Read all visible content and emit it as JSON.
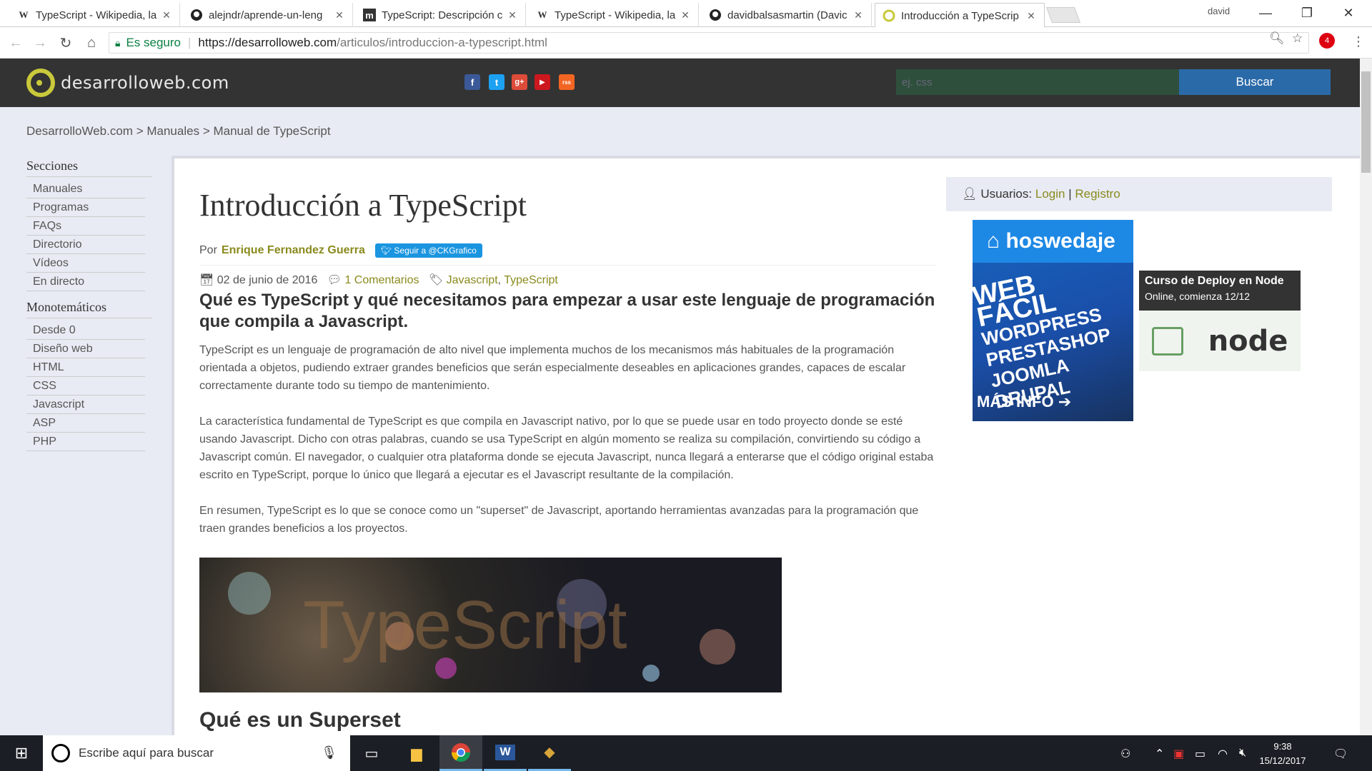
{
  "browser": {
    "tabs": [
      {
        "title": "TypeScript - Wikipedia, la",
        "favicon": "W"
      },
      {
        "title": "alejndr/aprende-un-leng",
        "favicon": "github-icon"
      },
      {
        "title": "TypeScript: Descripción c",
        "favicon": "m"
      },
      {
        "title": "TypeScript - Wikipedia, la",
        "favicon": "W"
      },
      {
        "title": "davidbalsasmartin (Davic",
        "favicon": "github-icon"
      },
      {
        "title": "Introducción a TypeScrip",
        "favicon": "dw"
      }
    ],
    "user": "david",
    "secure_label": "Es seguro",
    "url_host": "https://desarrolloweb.com",
    "url_path": "/articulos/introduccion-a-typescript.html",
    "ext_badge": "4"
  },
  "site": {
    "logo": "desarrolloweb.com",
    "social": [
      "f",
      "t",
      "g+",
      "▶",
      "rss"
    ],
    "search_placeholder": "ej. css",
    "search_button": "Buscar",
    "breadcrumb": [
      "DesarrolloWeb.com",
      "Manuales",
      "Manual de TypeScript"
    ]
  },
  "sidebar": {
    "sections_title": "Secciones",
    "sections": [
      "Manuales",
      "Programas",
      "FAQs",
      "Directorio",
      "Vídeos",
      "En directo"
    ],
    "mono_title": "Monotemáticos",
    "mono": [
      "Desde 0",
      "Diseño web",
      "HTML",
      "CSS",
      "Javascript",
      "ASP",
      "PHP"
    ]
  },
  "article": {
    "title": "Introducción a TypeScript",
    "by": "Por",
    "author": "Enrique Fernandez Guerra",
    "follow": "Seguir a @CKGrafico",
    "date": "02 de junio de 2016",
    "comments": "1 Comentarios",
    "tag1": "Javascript",
    "tag2": "TypeScript",
    "subtitle": "Qué es TypeScript y qué necesitamos para empezar a usar este lenguaje de programación que compila a Javascript.",
    "p1": "TypeScript es un lenguaje de programación de alto nivel que implementa muchos de los mecanismos más habituales de la programación orientada a objetos, pudiendo extraer grandes beneficios que serán especialmente deseables en aplicaciones grandes, capaces de escalar correctamente durante todo su tiempo de mantenimiento.",
    "p2": "La característica fundamental de TypeScript es que compila en Javascript nativo, por lo que se puede usar en todo proyecto donde se esté usando Javascript. Dicho con otras palabras, cuando se usa TypeScript en algún momento se realiza su compilación, convirtiendo su código a Javascript común. El navegador, o cualquier otra plataforma donde se ejecuta Javascript, nunca llegará a enterarse que el código original estaba escrito en TypeScript, porque lo único que llegará a ejecutar es el Javascript resultante de la compilación.",
    "p3": "En resumen, TypeScript es lo que se conoce como un \"superset\" de Javascript, aportando herramientas avanzadas para la programación que traen grandes beneficios a los proyectos.",
    "hero_text": "TypeScript",
    "next_heading": "Qué es un Superset"
  },
  "right": {
    "users_label": "Usuarios:",
    "login": "Login",
    "divider": "|",
    "register": "Registro",
    "ad1_brand": "hoswedaje",
    "ad1_lines": [
      "WEB FÁCIL",
      "WORDPRESS",
      "PRESTASHOP",
      "JOOMLA",
      "DRUPAL"
    ],
    "ad1_more": "MÁS INFO",
    "ad2_title": "Curso de Deploy en Node",
    "ad2_sub": "Online, comienza 12/12",
    "ad2_logo": "node"
  },
  "taskbar": {
    "search_placeholder": "Escribe aquí para buscar",
    "time": "9:38",
    "date": "15/12/2017"
  },
  "colors": {
    "header_bg": "#333333",
    "link": "#8a8a1e",
    "search_button": "#2b6aa8",
    "page_bg": "#e8ebf3"
  }
}
